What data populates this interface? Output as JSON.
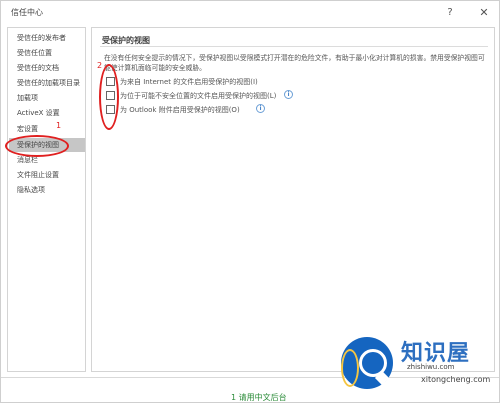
{
  "window": {
    "title": "信任中心",
    "help_icon": "?",
    "close_icon": "✕"
  },
  "sidebar": {
    "items": [
      {
        "label": "受信任的发布者"
      },
      {
        "label": "受信任位置"
      },
      {
        "label": "受信任的文档"
      },
      {
        "label": "受信任的加载项目录"
      },
      {
        "label": "加载项"
      },
      {
        "label": "ActiveX 设置"
      },
      {
        "label": "宏设置"
      },
      {
        "label": "受保护的视图",
        "selected": true
      },
      {
        "label": "消息栏"
      },
      {
        "label": "文件阻止设置"
      },
      {
        "label": "隐私选项"
      }
    ]
  },
  "main": {
    "section_title": "受保护的视图",
    "description": "在没有任何安全提示的情况下，受保护视图以受限模式打开潜在的危险文件，有助于最小化对计算机的损害。禁用受保护视图可能使计算机面临可能的安全威胁。",
    "options": [
      {
        "label": "为来自 Internet 的文件启用受保护的视图(I)",
        "checked": false
      },
      {
        "label": "为位于可能不安全位置的文件启用受保护的视图(L)",
        "checked": false,
        "info_icon": "i"
      },
      {
        "label": "为 Outlook 附件启用受保护的视图(O)",
        "checked": false,
        "info_icon": "i"
      }
    ]
  },
  "annotations": {
    "marker_1": "1",
    "marker_2": "2"
  },
  "footer": {
    "partial_text": "1 请用中文后台"
  },
  "watermark": {
    "brand": "知识屋",
    "url1": "zhishiwu.com",
    "url2": "xitongcheng.com"
  },
  "colors": {
    "annotation_red": "#e02020",
    "watermark_blue": "#1565c0",
    "selected_bg": "#c6c6c6"
  }
}
